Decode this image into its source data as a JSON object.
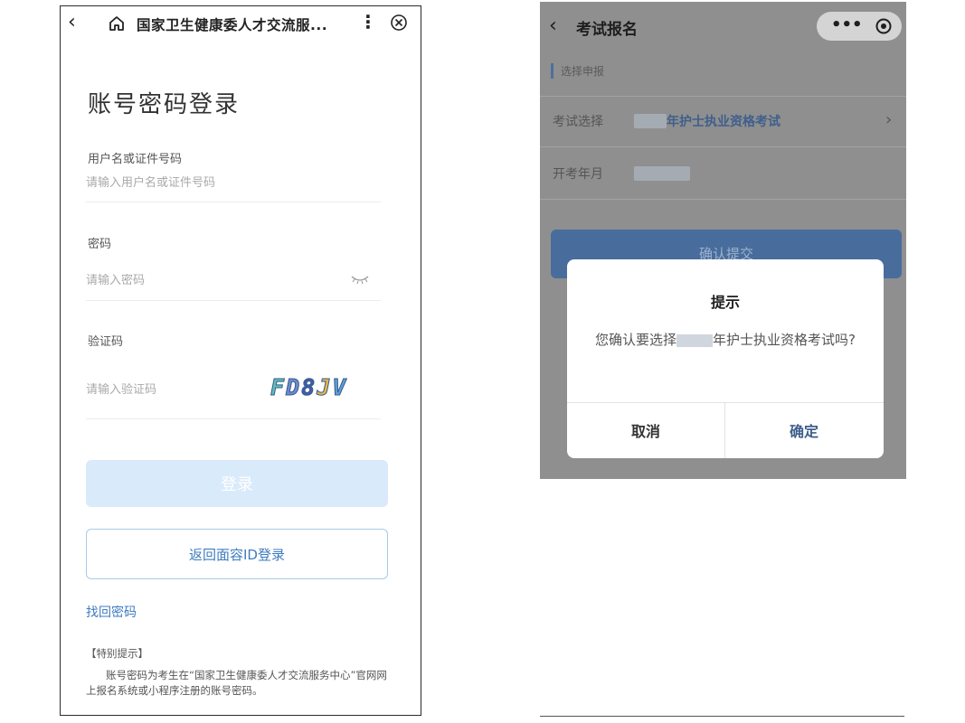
{
  "left": {
    "navbar": {
      "back_icon": "chevron-left-icon",
      "home_icon": "home-icon",
      "title": "国家卫生健康委人才交流服...",
      "more_icon": "more-vertical-icon",
      "close_icon": "close-circle-icon"
    },
    "login_title": "账号密码登录",
    "username": {
      "label": "用户名或证件号码",
      "placeholder": "请输入用户名或证件号码"
    },
    "password": {
      "label": "密码",
      "placeholder": "请输入密码",
      "toggle_icon": "eye-closed-icon"
    },
    "captcha": {
      "label": "验证码",
      "placeholder": "请输入验证码",
      "chars": [
        "F",
        "D",
        "8",
        "J",
        "V"
      ],
      "colors": [
        "#5ec0b8",
        "#6a8bd1",
        "#3e5fa8",
        "#e0b84a",
        "#5aa0d8"
      ]
    },
    "login_button": "登录",
    "face_login_button": "返回面容ID登录",
    "forgot_link": "找回密码",
    "notice_title": "【特别提示】",
    "notice_body": "账号密码为考生在“国家卫生健康委人才交流服务中心”官网网上报名系统或小程序注册的账号密码。"
  },
  "right": {
    "navbar": {
      "back_icon": "chevron-left-icon",
      "title": "考试报名",
      "more_icon": "more-horizontal-icon",
      "target_icon": "target-icon"
    },
    "section_title": "选择申报",
    "rows": [
      {
        "label": "考试选择",
        "value": "年护士执业资格考试"
      },
      {
        "label": "开考年月",
        "value": ""
      }
    ],
    "confirm_submit": "确认提交",
    "dialog": {
      "title": "提示",
      "message_prefix": "您确认要选择",
      "message_suffix": "年护士执业资格考试吗?",
      "cancel": "取消",
      "ok": "确定"
    }
  },
  "colors": {
    "accent_blue": "#3d7cc0",
    "disabled_button": "#d9eafb",
    "overlay_gray": "#8f8f8f"
  }
}
